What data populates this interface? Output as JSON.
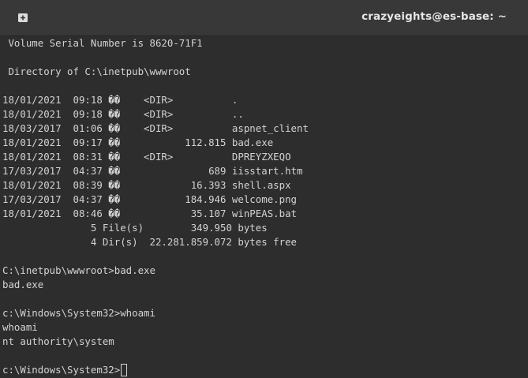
{
  "window": {
    "title": "crazyeights@es-base: ~",
    "new_tab_icon": "new-tab-plus-icon"
  },
  "terminal": {
    "lines": [
      " Volume Serial Number is 8620-71F1",
      "",
      " Directory of C:\\inetpub\\wwwroot",
      "",
      "18/01/2021  09:18 ��    <DIR>          .",
      "18/01/2021  09:18 ��    <DIR>          ..",
      "18/03/2017  01:06 ��    <DIR>          aspnet_client",
      "18/01/2021  09:17 ��           112.815 bad.exe",
      "18/01/2021  08:31 ��    <DIR>          DPREYZXEQO",
      "17/03/2017  04:37 ��               689 iisstart.htm",
      "18/01/2021  08:39 ��            16.393 shell.aspx",
      "17/03/2017  04:37 ��           184.946 welcome.png",
      "18/01/2021  08:46 ��            35.107 winPEAS.bat",
      "               5 File(s)        349.950 bytes",
      "               4 Dir(s)  22.281.859.072 bytes free",
      "",
      "C:\\inetpub\\wwwroot>bad.exe",
      "bad.exe",
      "",
      "c:\\Windows\\System32>whoami",
      "whoami",
      "nt authority\\system",
      ""
    ],
    "prompt": "c:\\Windows\\System32>"
  }
}
